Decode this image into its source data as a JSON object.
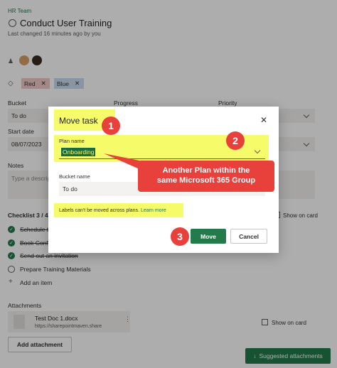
{
  "header": {
    "team": "HR Team",
    "task_title": "Conduct User Training",
    "last_changed": "Last changed 16 minutes ago by you"
  },
  "labels": [
    {
      "name": "Red",
      "color": "#f0c9c9"
    },
    {
      "name": "Blue",
      "color": "#c9ddf2"
    }
  ],
  "fields": {
    "bucket_label": "Bucket",
    "bucket_value": "To do",
    "progress_label": "Progress",
    "priority_label": "Priority",
    "start_date_label": "Start date",
    "start_date_value": "08/07/2023",
    "notes_label": "Notes",
    "notes_placeholder": "Type a descrip"
  },
  "checklist": {
    "heading": "Checklist 3 / 4",
    "show_on_card": "Show on card",
    "items": [
      {
        "text": "Schedule t",
        "done": true
      },
      {
        "text": "Book Conf",
        "done": true
      },
      {
        "text": "Send out an invitation",
        "done": true
      },
      {
        "text": "Prepare Training Materials",
        "done": false
      }
    ],
    "add_item": "Add an item"
  },
  "attachments": {
    "heading": "Attachments",
    "file_name": "Test Doc 1.docx",
    "file_url": "https://sharepointmaven.share",
    "show_on_card": "Show on card",
    "add_button": "Add attachment",
    "suggested_button": "Suggested attachments"
  },
  "dialog": {
    "title": "Move task",
    "plan_label": "Plan name",
    "plan_value": "Onboarding",
    "bucket_label": "Bucket name",
    "bucket_value": "To do",
    "note": "Labels can't be moved across plans.",
    "learn_more": "Learn more",
    "move_button": "Move",
    "cancel_button": "Cancel"
  },
  "callout": {
    "line1": "Another Plan within the",
    "line2": "same Microsoft 365 Group"
  },
  "badges": [
    "1",
    "2",
    "3"
  ],
  "colors": {
    "accent_green": "#237b4b",
    "highlight_yellow": "#f6fb6a",
    "callout_red": "#e8413c"
  }
}
